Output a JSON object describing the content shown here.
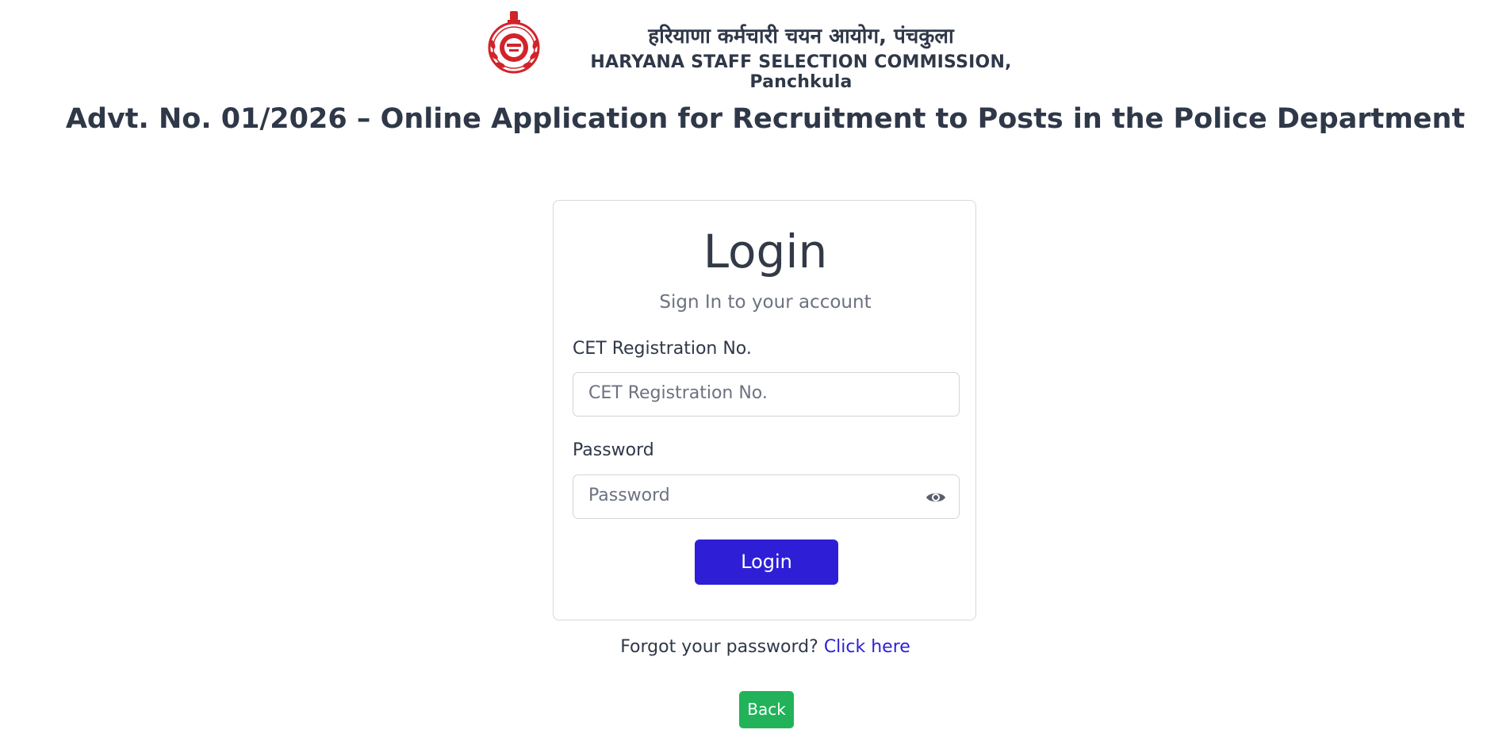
{
  "header": {
    "hindi_title": "हरियाणा कर्मचारी चयन आयोग, पंचकुला",
    "english_title": "HARYANA STAFF SELECTION COMMISSION, Panchkula",
    "emblem_icon": "haryana-emblem-icon"
  },
  "page": {
    "advt_title": "Advt. No. 01/2026 – Online Application for Recruitment to Posts in the Police Department"
  },
  "login_card": {
    "title": "Login",
    "subtitle": "Sign In to your account",
    "registration": {
      "label": "CET Registration No.",
      "placeholder": "CET Registration No.",
      "value": ""
    },
    "password": {
      "label": "Password",
      "placeholder": "Password",
      "value": "",
      "toggle_icon": "eye-icon"
    },
    "submit_label": "Login"
  },
  "forgot": {
    "text": "Forgot your password?",
    "link_text": "Click here"
  },
  "back_label": "Back",
  "colors": {
    "primary": "#2e1fd6",
    "success": "#22b35a",
    "text": "#2f3848",
    "muted": "#6c7280",
    "emblem": "#d2232a"
  }
}
